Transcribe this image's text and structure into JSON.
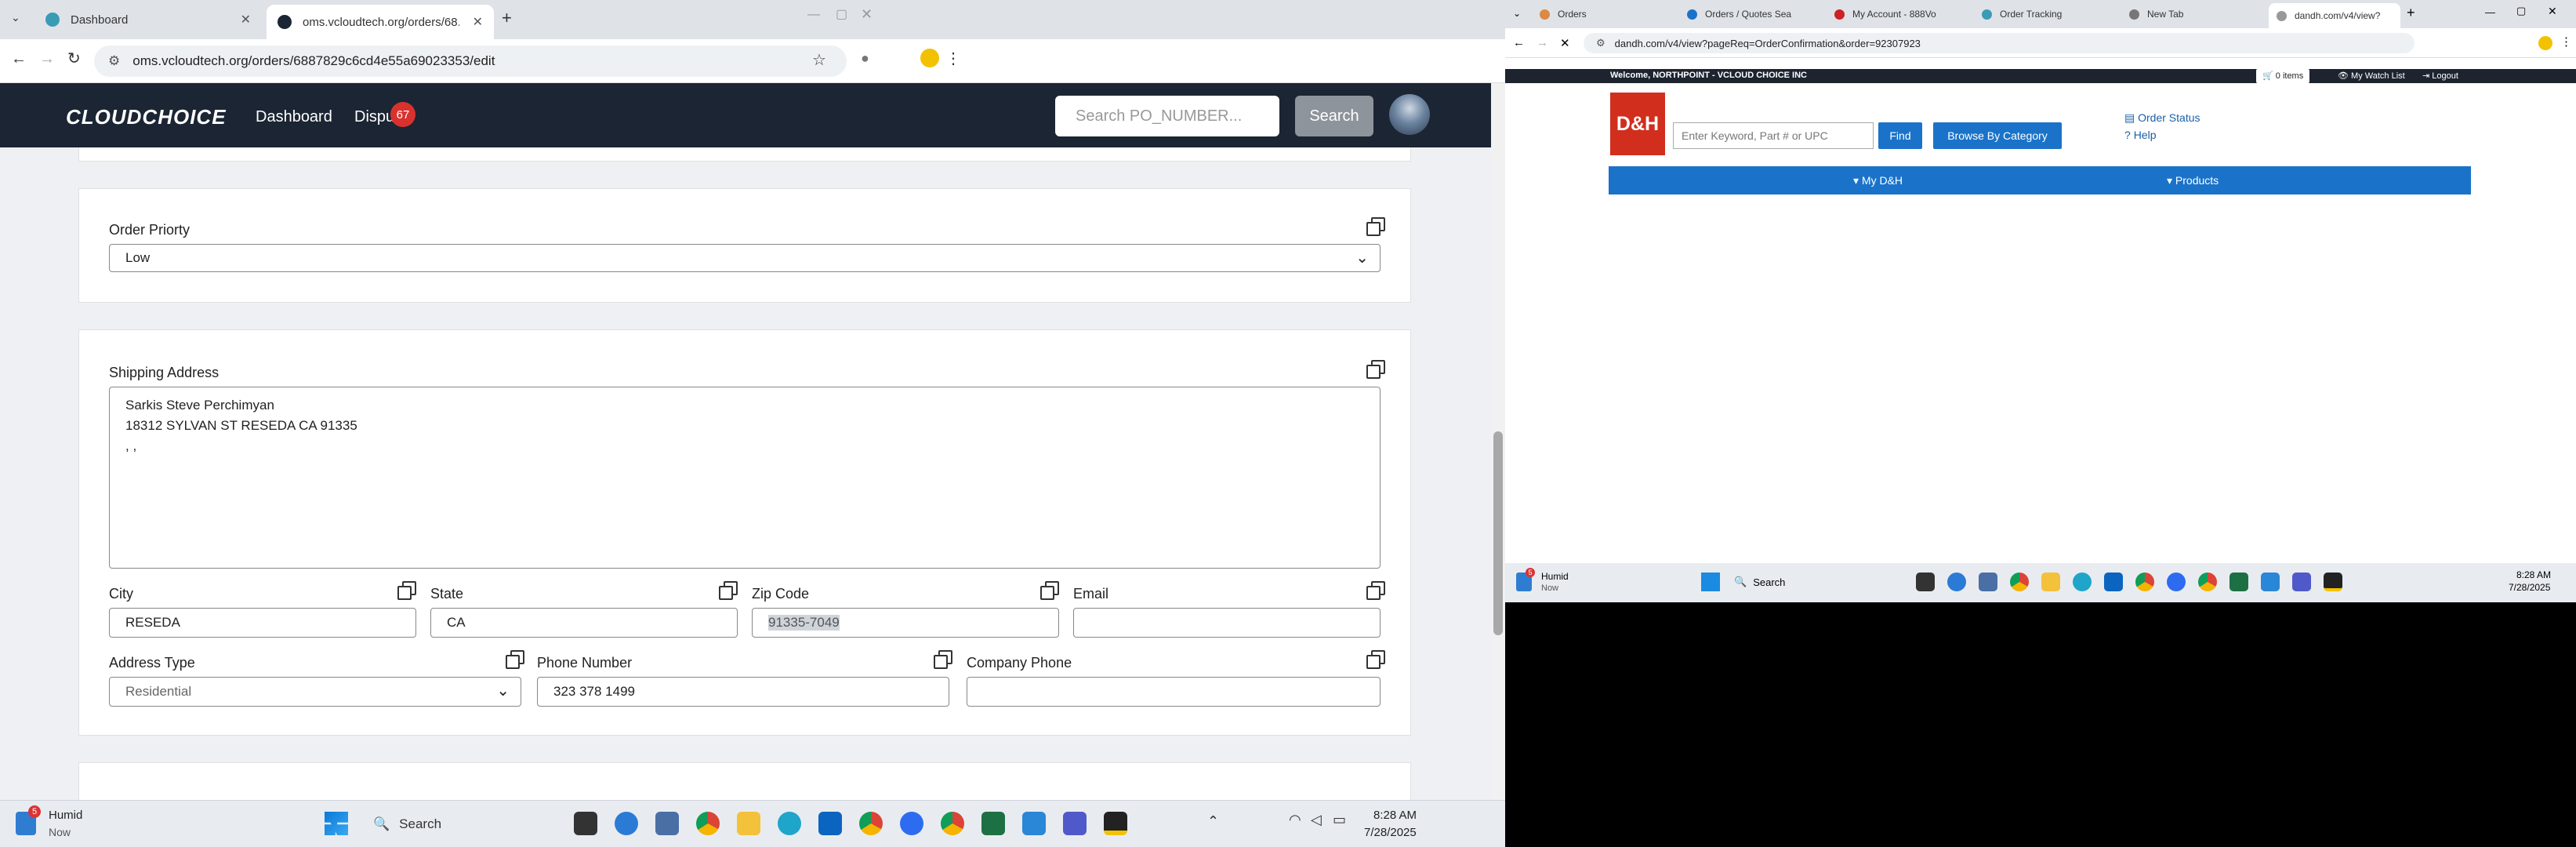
{
  "left": {
    "tabs": [
      {
        "title": "Dashboard"
      },
      {
        "title": "oms.vcloudtech.org/orders/68..."
      }
    ],
    "url": "oms.vcloudtech.org/orders/6887829c6cd4e55a69023353/edit",
    "brand": "CLOUDCHOICE",
    "nav": {
      "dashboard": "Dashboard",
      "disputes": "Dispu",
      "disputes_badge": "67"
    },
    "search": {
      "placeholder": "Search PO_NUMBER...",
      "button": "Search"
    },
    "order_priority": {
      "label": "Order Priorty",
      "value": "Low"
    },
    "shipping": {
      "label": "Shipping Address",
      "line1": "Sarkis Steve Perchimyan",
      "line2": "18312 SYLVAN ST RESEDA CA 91335",
      "line3": ", ,"
    },
    "city": {
      "label": "City",
      "value": "RESEDA"
    },
    "state": {
      "label": "State",
      "value": "CA"
    },
    "zip": {
      "label": "Zip Code",
      "value": "91335-7049"
    },
    "email": {
      "label": "Email",
      "value": ""
    },
    "address_type": {
      "label": "Address Type",
      "value": "Residential"
    },
    "phone": {
      "label": "Phone Number",
      "value": "323 378 1499"
    },
    "company_phone": {
      "label": "Company Phone",
      "value": ""
    },
    "taskbar": {
      "weather_badge": "5",
      "weather_title": "Humid",
      "weather_sub": "Now",
      "search": "Search",
      "time": "8:28 AM",
      "date": "7/28/2025"
    }
  },
  "right": {
    "tabs": [
      {
        "title": "Orders"
      },
      {
        "title": "Orders / Quotes Sea"
      },
      {
        "title": "My Account - 888Vo"
      },
      {
        "title": "Order Tracking"
      },
      {
        "title": "New Tab"
      },
      {
        "title": "dandh.com/v4/view?"
      }
    ],
    "url": "dandh.com/v4/view?pageReq=OrderConfirmation&order=92307923",
    "welcome": "Welcome, NORTHPOINT - VCLOUD CHOICE INC",
    "cart": "0 items",
    "watchlist": "My Watch List",
    "logout": "Logout",
    "logo": "D&H",
    "search_placeholder": "Enter Keyword, Part # or UPC",
    "find": "Find",
    "browse": "Browse By Category",
    "order_status": "Order Status",
    "help": "Help",
    "menu_my": "My D&H",
    "menu_products": "Products",
    "taskbar": {
      "weather_badge": "5",
      "weather_title": "Humid",
      "weather_sub": "Now",
      "search": "Search",
      "time": "8:28 AM",
      "date": "7/28/2025"
    }
  }
}
